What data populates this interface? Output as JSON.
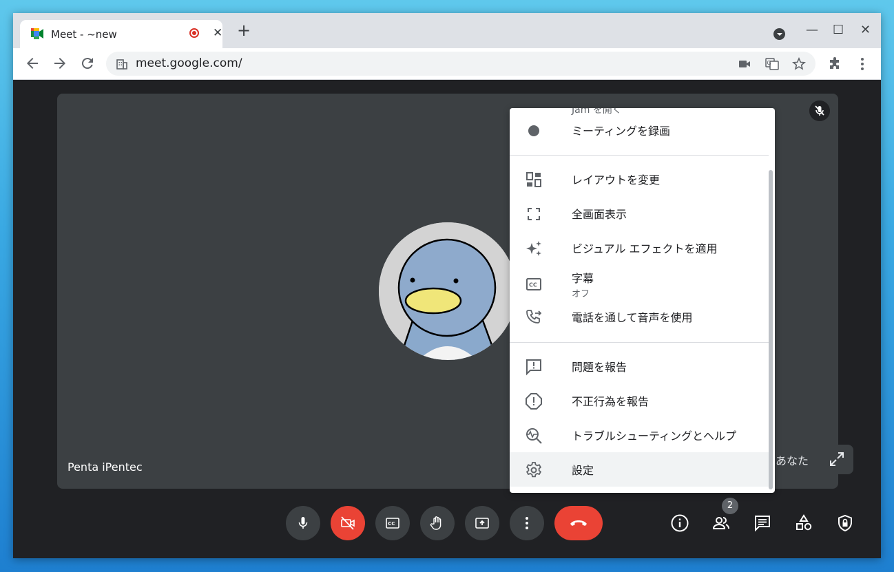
{
  "browser": {
    "tab_title": "Meet - ~new",
    "tab_close": "✕",
    "new_tab": "+",
    "url": "meet.google.com/",
    "window_controls": {
      "minimize": "—",
      "maximize": "☐",
      "close": "✕"
    }
  },
  "meeting": {
    "participant_name": "Penta iPentec",
    "self_label": "あなた",
    "participant_count": "2"
  },
  "menu": {
    "cut_off_item": "Jam を開く",
    "items": [
      {
        "label": "ミーティングを録画",
        "icon": "record-icon"
      },
      {
        "label": "レイアウトを変更",
        "icon": "layout-icon"
      },
      {
        "label": "全画面表示",
        "icon": "fullscreen-icon"
      },
      {
        "label": "ビジュアル エフェクトを適用",
        "icon": "sparkle-icon"
      },
      {
        "label": "字幕",
        "sublabel": "オフ",
        "icon": "captions-icon"
      },
      {
        "label": "電話を通して音声を使用",
        "icon": "phone-forward-icon"
      },
      {
        "label": "問題を報告",
        "icon": "feedback-icon"
      },
      {
        "label": "不正行為を報告",
        "icon": "report-icon"
      },
      {
        "label": "トラブルシューティングとヘルプ",
        "icon": "troubleshoot-icon"
      },
      {
        "label": "設定",
        "icon": "settings-icon"
      }
    ]
  },
  "colors": {
    "meet_bg": "#202124",
    "tile_bg": "#3c4043",
    "accent_red": "#ea4335"
  }
}
